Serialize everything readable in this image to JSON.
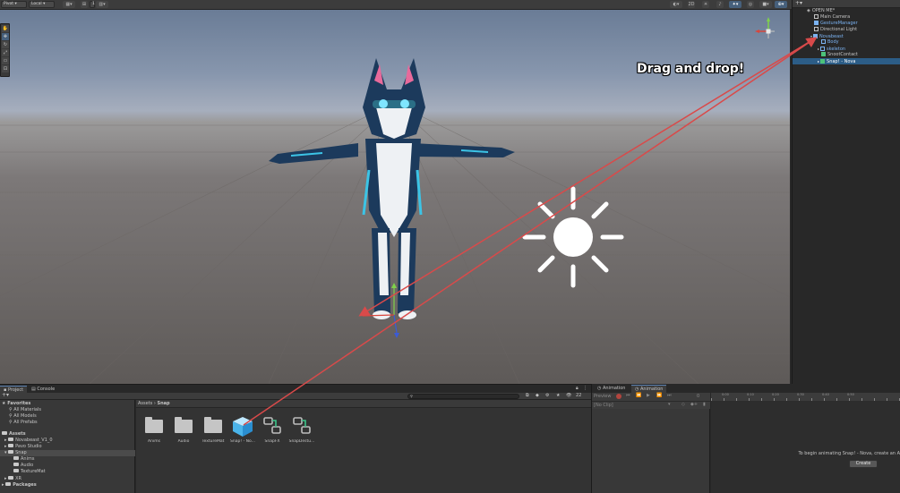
{
  "scene_toolbar": {
    "pivot": "Pivot",
    "local": "Local",
    "snap_value": "1"
  },
  "scene": {
    "overlay_text": "Drag and drop!",
    "gizmo_axes": [
      "y",
      "z",
      "x"
    ]
  },
  "hierarchy": {
    "scene_name": "OPEN ME*",
    "items": [
      {
        "label": "Main Camera"
      },
      {
        "label": "GestureManager"
      },
      {
        "label": "Directional Light"
      },
      {
        "label": "Novabeast"
      },
      {
        "label": "Body"
      },
      {
        "label": "skeleton"
      },
      {
        "label": "SnootContact"
      },
      {
        "label": "Snap! - Nova"
      }
    ]
  },
  "bottom_tabs": {
    "project": "Project",
    "console": "Console"
  },
  "project": {
    "hidden_count": "22",
    "breadcrumb_root": "Assets",
    "breadcrumb_sep": "›",
    "breadcrumb_current": "Snap",
    "favorites_label": "Favorites",
    "favorites": [
      "All Materials",
      "All Models",
      "All Prefabs"
    ],
    "assets_label": "Assets",
    "asset_folders": [
      "Novabeast_V1_0",
      "Pavo Studio",
      "Snap"
    ],
    "snap_children": [
      "Anims",
      "Audio",
      "TextureMat"
    ],
    "xr_label": "XR",
    "packages_label": "Packages",
    "grid_items": [
      "Anims",
      "Audio",
      "TextureMat",
      "Snap! - No...",
      "SnapFX",
      "SnapDestu..."
    ]
  },
  "animation": {
    "tab1": "Animation",
    "tab2": "Animation",
    "preview_label": "Preview",
    "frame_value": "0",
    "clip_placeholder": "[No Clip]",
    "message": "To begin animating Snap! - Nova, create an A",
    "create_label": "Create",
    "ruler_ticks": [
      "0:00",
      "0:05",
      "0:10",
      "0:15",
      "0:20",
      "0:25",
      "0:30",
      "0:35",
      "0:40",
      "0:45",
      "0:50"
    ]
  },
  "colors": {
    "selection": "#2c5d87",
    "arrow": "#d94a4a",
    "prefab_blue": "#7bb3f2"
  }
}
